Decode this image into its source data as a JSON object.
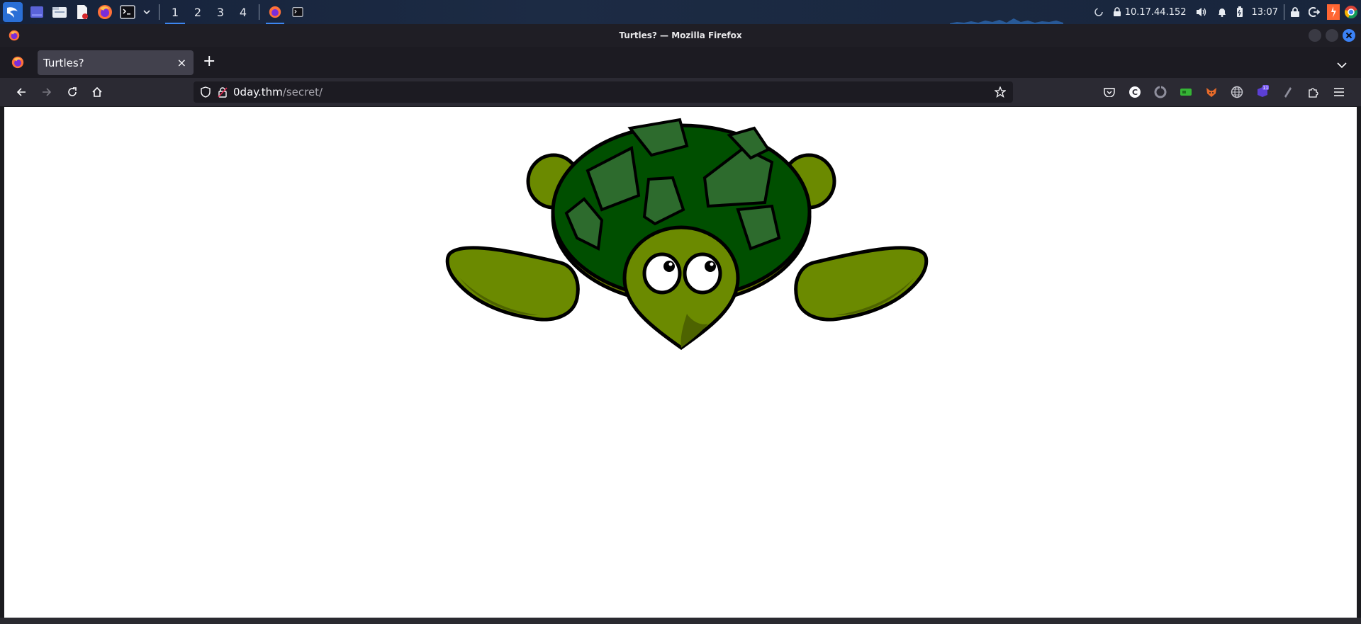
{
  "taskbar": {
    "workspaces": [
      "1",
      "2",
      "3",
      "4"
    ],
    "active_workspace": "1",
    "app_icons": [
      "kali-menu-icon",
      "desktop-icon",
      "files-icon",
      "text-editor-icon",
      "firefox-icon",
      "terminal-icon"
    ],
    "ip_address": "10.17.44.152",
    "clock": "13:07"
  },
  "window": {
    "title": "Turtles? — Mozilla Firefox"
  },
  "browser": {
    "tab": {
      "label": "Turtles?",
      "close": "×"
    },
    "new_tab": "+",
    "url_host": "0day.thm",
    "url_path": "/secret/"
  },
  "page": {
    "image": "turtle-cartoon-image"
  },
  "colors": {
    "shell_dark": "#004f00",
    "shell_plate": "#2d6b2d",
    "body_olive": "#6b8a00"
  }
}
